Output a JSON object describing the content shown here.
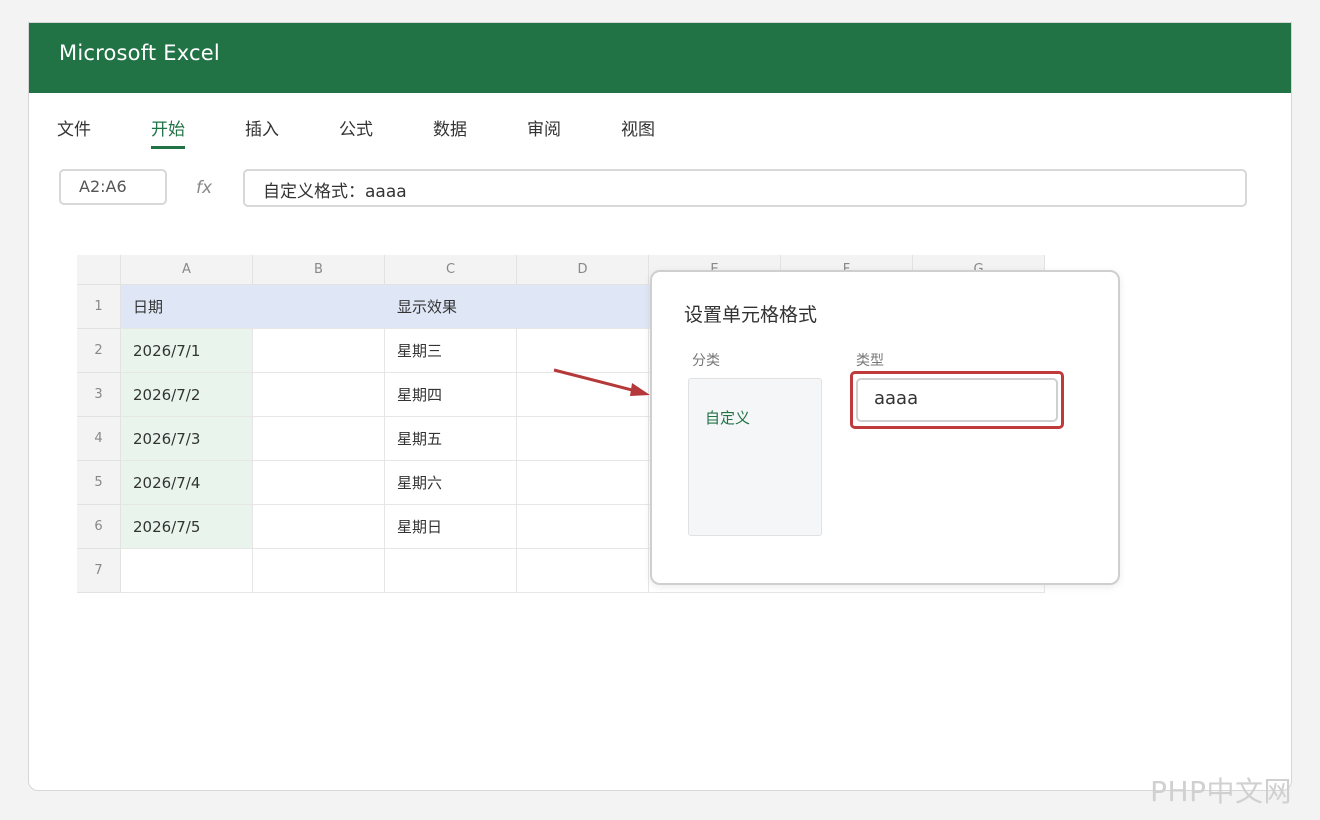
{
  "app": {
    "title": "Microsoft Excel"
  },
  "tabs": [
    "文件",
    "开始",
    "插入",
    "公式",
    "数据",
    "审阅",
    "视图"
  ],
  "active_tab": "开始",
  "formula_bar": {
    "name_box": "A2:A6",
    "fx_label": "fx",
    "formula": "自定义格式：aaaa"
  },
  "sheet": {
    "columns": [
      "A",
      "B",
      "C",
      "D",
      "E",
      "F",
      "G"
    ],
    "rows": [
      {
        "num": "1",
        "cells": [
          "日期",
          "",
          "显示效果",
          "",
          "",
          "",
          ""
        ]
      },
      {
        "num": "2",
        "cells": [
          "2026/7/1",
          "",
          "星期三",
          "",
          "",
          "",
          ""
        ]
      },
      {
        "num": "3",
        "cells": [
          "2026/7/2",
          "",
          "星期四",
          "",
          "",
          "",
          ""
        ]
      },
      {
        "num": "4",
        "cells": [
          "2026/7/3",
          "",
          "星期五",
          "",
          "",
          "",
          ""
        ]
      },
      {
        "num": "5",
        "cells": [
          "2026/7/4",
          "",
          "星期六",
          "",
          "",
          "",
          ""
        ]
      },
      {
        "num": "6",
        "cells": [
          "2026/7/5",
          "",
          "星期日",
          "",
          "",
          "",
          ""
        ]
      },
      {
        "num": "7",
        "cells": [
          "",
          "",
          "",
          "",
          "",
          "",
          ""
        ]
      }
    ]
  },
  "dialog": {
    "title": "设置单元格格式",
    "category_label": "分类",
    "type_label": "类型",
    "category_selected": "自定义",
    "type_value": "aaaa"
  },
  "watermark": "PHP中文网",
  "colors": {
    "brand": "#217346",
    "highlight": "#c0393b",
    "header_row": "#dfe7f6",
    "selection": "#e9f5ec"
  }
}
